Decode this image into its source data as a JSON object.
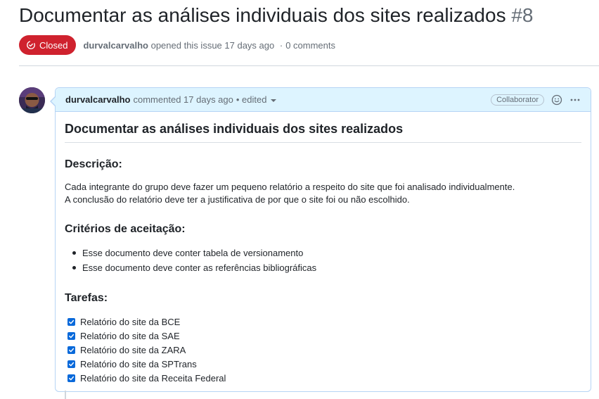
{
  "issue": {
    "title": "Documentar as análises individuais dos sites realizados",
    "number": "#8",
    "state": "Closed",
    "state_color": "#cf222e",
    "author": "durvalcarvalho",
    "opened_text": "opened this issue 17 days ago",
    "separator": "·",
    "comments_count": "0 comments"
  },
  "comment": {
    "author": "durvalcarvalho",
    "action_text": "commented 17 days ago",
    "edited_text": "• edited",
    "role_badge": "Collaborator",
    "reaction_icon": "smiley-icon",
    "menu_icon": "kebab-horizontal-icon",
    "accent_color": "#0969da",
    "body": {
      "heading": "Documentar as análises individuais dos sites realizados",
      "description_heading": "Descrição:",
      "description_lines": [
        "Cada integrante do grupo deve fazer um pequeno relatório a respeito do site que foi analisado individualmente.",
        "A conclusão do relatório deve ter a justificativa de por que o site foi ou não escolhido."
      ],
      "criteria_heading": "Critérios de aceitação:",
      "criteria": [
        "Esse documento deve conter tabela de versionamento",
        "Esse documento deve conter as referências bibliográficas"
      ],
      "tasks_heading": "Tarefas:",
      "tasks": [
        {
          "label": "Relatório do site da BCE",
          "checked": true
        },
        {
          "label": "Relatório do site da SAE",
          "checked": true
        },
        {
          "label": "Relatório do site da ZARA",
          "checked": true
        },
        {
          "label": "Relatório do site da SPTrans",
          "checked": true
        },
        {
          "label": "Relatório do site da Receita Federal",
          "checked": true
        }
      ]
    }
  }
}
